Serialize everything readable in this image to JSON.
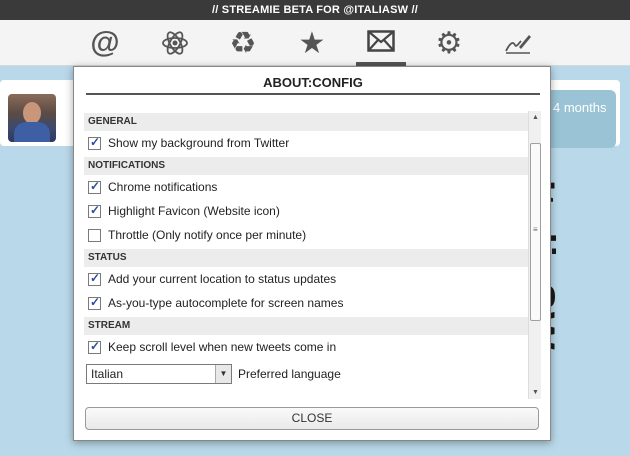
{
  "window": {
    "title": "// STREAMIE BETA FOR @ITALIASW //"
  },
  "toolbar": {
    "items": [
      {
        "icon": "at-icon",
        "glyph": "@"
      },
      {
        "icon": "atom-icon"
      },
      {
        "icon": "recycle-icon",
        "glyph": "♻"
      },
      {
        "icon": "star-icon",
        "glyph": "★"
      },
      {
        "icon": "envelope-icon"
      },
      {
        "icon": "gear-icon",
        "glyph": "⚙"
      },
      {
        "icon": "signature-icon"
      }
    ],
    "active": "envelope-icon"
  },
  "timeline": {
    "time_label": "4 months",
    "side_text": "ItaliaSW"
  },
  "dialog": {
    "title": "ABOUT:CONFIG",
    "sections": {
      "general": {
        "label": "GENERAL",
        "options": [
          {
            "label": "Show my background from Twitter",
            "checked": true
          }
        ]
      },
      "notifications": {
        "label": "NOTIFICATIONS",
        "options": [
          {
            "label": "Chrome notifications",
            "checked": true
          },
          {
            "label": "Highlight Favicon (Website icon)",
            "checked": true
          },
          {
            "label": "Throttle (Only notify once per minute)",
            "checked": false
          }
        ]
      },
      "status": {
        "label": "STATUS",
        "options": [
          {
            "label": "Add your current location to status updates",
            "checked": true
          },
          {
            "label": "As-you-type autocomplete for screen names",
            "checked": true
          }
        ]
      },
      "stream": {
        "label": "STREAM",
        "options": [
          {
            "label": "Keep scroll level when new tweets come in",
            "checked": true
          }
        ],
        "language": {
          "value": "Italian",
          "label": "Preferred language"
        }
      }
    },
    "close_label": "CLOSE"
  },
  "colors": {
    "background": "#b9d9ea",
    "titlebar": "#3a3a3a",
    "checkmark": "#2a4ea0",
    "time_bubble": "#9ac4d6"
  }
}
